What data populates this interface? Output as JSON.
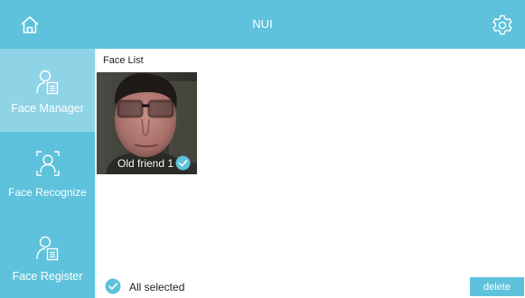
{
  "header": {
    "title": "NUI",
    "home_icon": "home-icon",
    "settings_icon": "gear-icon"
  },
  "sidebar": {
    "items": [
      {
        "label": "Face Manager",
        "icon": "user-document-icon",
        "active": true
      },
      {
        "label": "Face Recognize",
        "icon": "face-scan-icon",
        "active": false
      },
      {
        "label": "Face Register",
        "icon": "user-document-icon",
        "active": false
      }
    ]
  },
  "main": {
    "list_title": "Face List",
    "faces": [
      {
        "name": "Old friend 1",
        "selected": true
      }
    ],
    "select_all_label": "All selected",
    "delete_label": "delete"
  },
  "colors": {
    "accent": "#5ec2dc",
    "active_nav": "#8fd3e7",
    "check": "#5ec2dc"
  }
}
